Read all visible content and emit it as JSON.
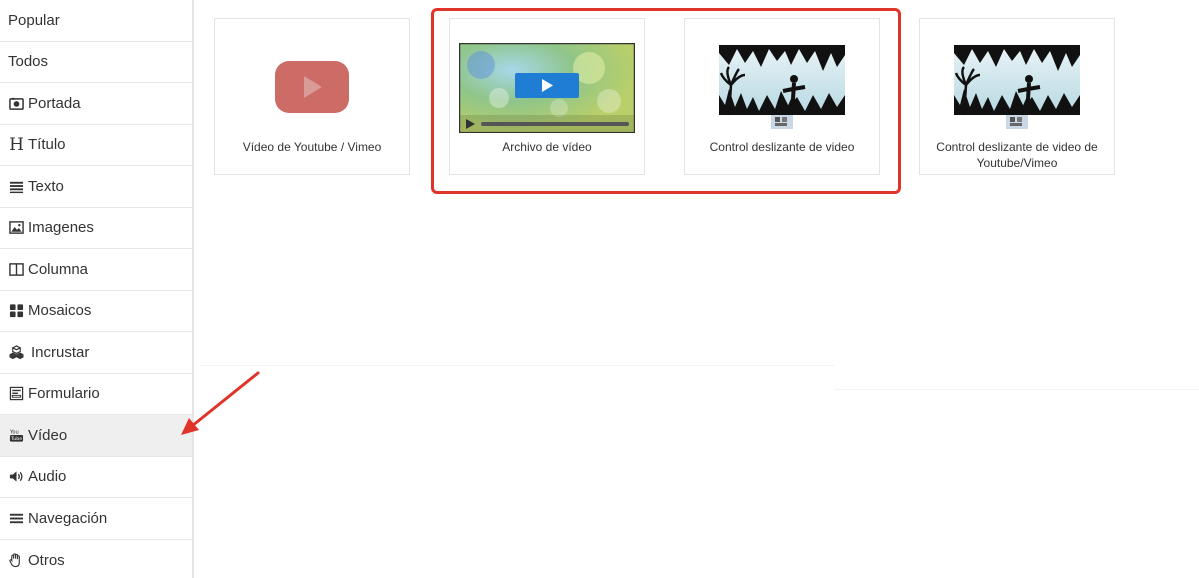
{
  "sidebar": {
    "items": [
      {
        "label": "Popular",
        "icon": "none"
      },
      {
        "label": "Todos",
        "icon": "none"
      },
      {
        "label": "Portada",
        "icon": "camera-icon"
      },
      {
        "label": "Título",
        "icon": "heading-icon"
      },
      {
        "label": "Texto",
        "icon": "text-lines-icon"
      },
      {
        "label": "Imagenes",
        "icon": "image-icon"
      },
      {
        "label": "Columna",
        "icon": "columns-icon"
      },
      {
        "label": "Mosaicos",
        "icon": "grid-icon"
      },
      {
        "label": "Incrustar",
        "icon": "cubes-icon"
      },
      {
        "label": "Formulario",
        "icon": "form-icon"
      },
      {
        "label": "Vídeo",
        "icon": "youtube-icon",
        "active": true
      },
      {
        "label": "Audio",
        "icon": "volume-icon"
      },
      {
        "label": "Navegación",
        "icon": "menu-icon"
      },
      {
        "label": "Otros",
        "icon": "hand-icon"
      }
    ]
  },
  "cards": [
    {
      "label": "Vídeo de Youtube / Vimeo",
      "thumbnail": "youtube-logo"
    },
    {
      "label": "Archivo de vídeo",
      "thumbnail": "video-player"
    },
    {
      "label": "Control deslizante de video",
      "thumbnail": "video-slider"
    },
    {
      "label": "Control deslizante de video de Youtube/Vimeo",
      "thumbnail": "youtube-video-slider"
    }
  ],
  "colors": {
    "highlight": "#e0342b",
    "youtube_red": "#cd6b67",
    "play_blue": "#1f7ed4",
    "active_bg": "#efefef"
  }
}
